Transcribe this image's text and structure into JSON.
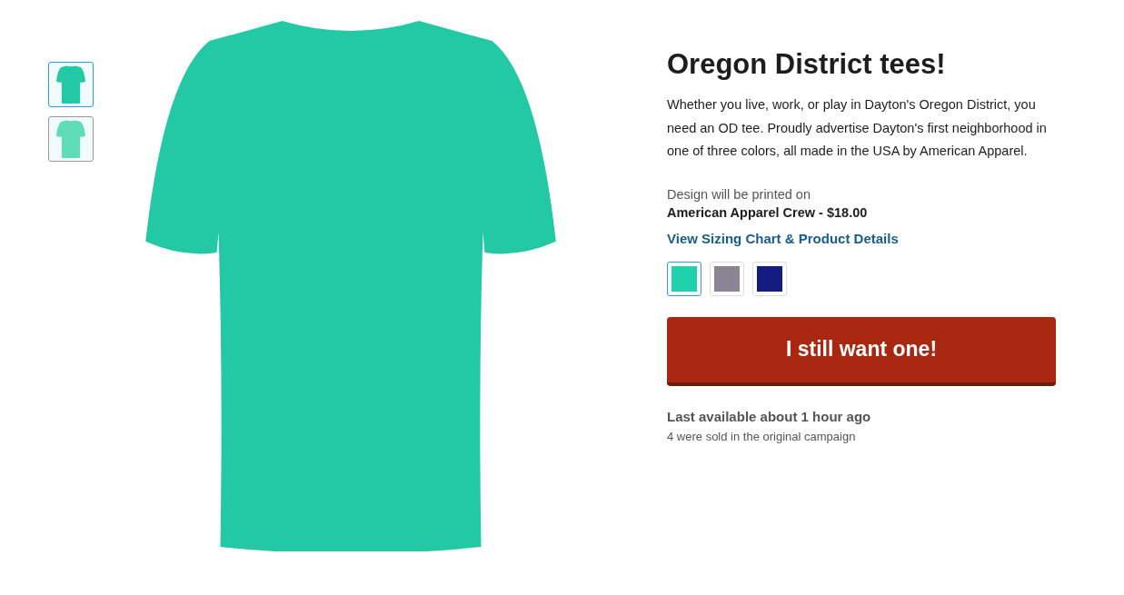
{
  "thumbnails": [
    {
      "selected": true
    },
    {
      "selected": false
    }
  ],
  "product": {
    "title": "Oregon District tees!",
    "description": "Whether you live, work, or play in Dayton's Oregon District, you need an OD tee. Proudly advertise Dayton's first neighborhood in one of three colors, all made in the USA by American Apparel.",
    "printed_on_label": "Design will be printed on",
    "product_name": "American Apparel Crew - $18.00",
    "details_link": "View Sizing Chart & Product Details",
    "swatches": [
      {
        "color": "#1fd1ad",
        "selected": true
      },
      {
        "color": "#8a8494",
        "selected": false
      },
      {
        "color": "#141c82",
        "selected": false
      }
    ],
    "buy_button": "I still want one!",
    "availability": "Last available about 1 hour ago",
    "sold_note": "4 were sold in the original campaign"
  }
}
